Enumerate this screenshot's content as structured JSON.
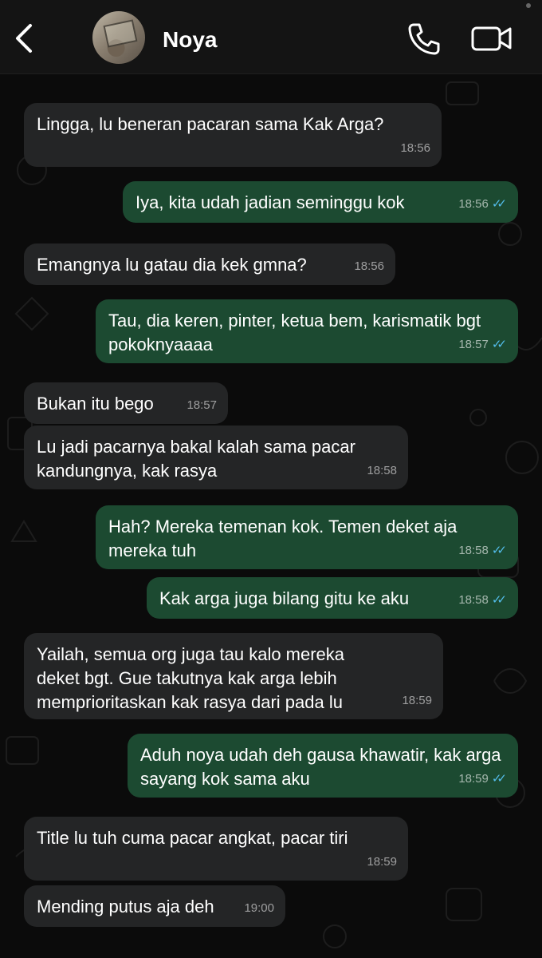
{
  "header": {
    "contact_name": "Noya"
  },
  "messages": [
    {
      "text": "Lingga, lu beneran pacaran sama Kak Arga?",
      "time": "18:56"
    },
    {
      "text": "Iya, kita udah jadian seminggu kok",
      "time": "18:56",
      "ticks": "✓✓"
    },
    {
      "text": "Emangnya lu gatau dia kek gmna?",
      "time": "18:56"
    },
    {
      "text": "Tau, dia keren, pinter, ketua bem, karismatik bgt pokoknyaaaa",
      "time": "18:57",
      "ticks": "✓✓"
    },
    {
      "text": "Bukan itu bego",
      "time": "18:57"
    },
    {
      "text": "Lu jadi pacarnya bakal kalah sama pacar kandungnya, kak rasya",
      "time": "18:58"
    },
    {
      "text": "Hah? Mereka temenan kok. Temen deket aja mereka tuh",
      "time": "18:58",
      "ticks": "✓✓"
    },
    {
      "text": "Kak arga juga bilang gitu ke aku",
      "time": "18:58",
      "ticks": "✓✓"
    },
    {
      "text": "Yailah, semua org juga tau kalo mereka deket bgt. Gue takutnya kak arga lebih memprioritaskan kak rasya dari pada lu",
      "time": "18:59"
    },
    {
      "text": "Aduh noya udah deh gausa khawatir, kak arga sayang kok sama aku",
      "time": "18:59",
      "ticks": "✓✓"
    },
    {
      "text": "Title lu tuh cuma pacar angkat, pacar tiri",
      "time": "18:59"
    },
    {
      "text": "Mending putus aja deh",
      "time": "19:00"
    }
  ],
  "colors": {
    "incoming_bubble": "#242526",
    "outgoing_bubble": "#1c4a31",
    "read_ticks": "#53bdeb"
  }
}
